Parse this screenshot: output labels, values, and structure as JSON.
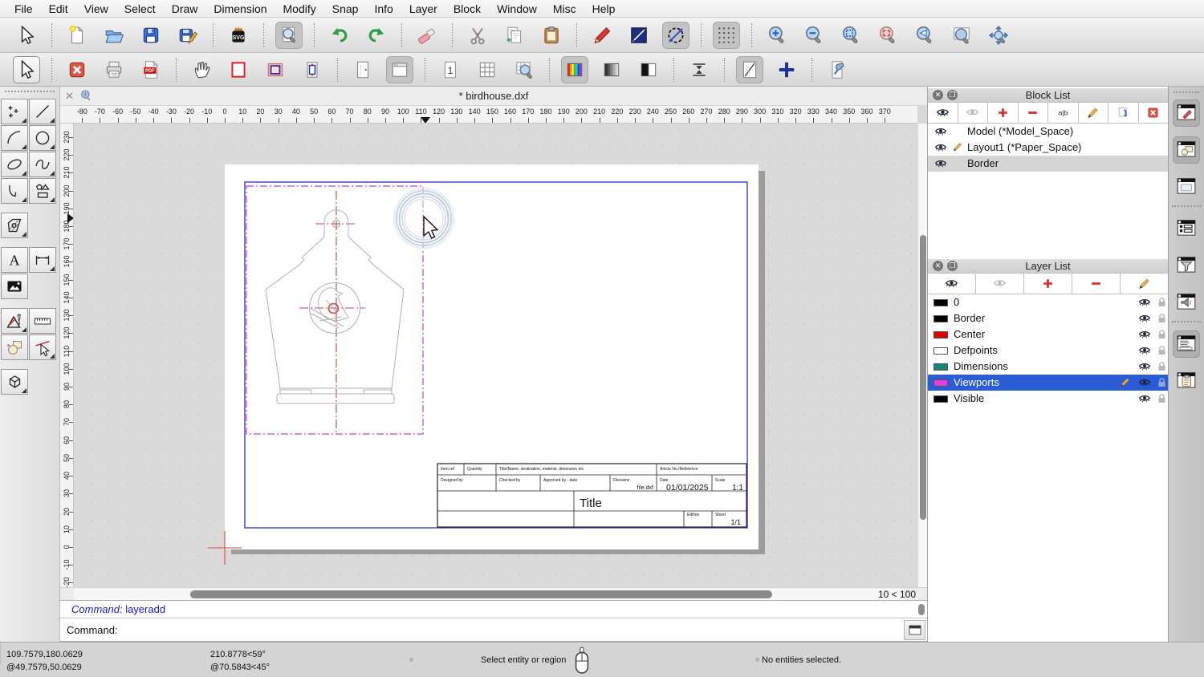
{
  "menu": {
    "items": [
      "File",
      "Edit",
      "View",
      "Select",
      "Draw",
      "Dimension",
      "Modify",
      "Snap",
      "Info",
      "Layer",
      "Block",
      "Window",
      "Misc",
      "Help"
    ]
  },
  "toolbar1": {
    "buttons": [
      "cursor",
      "|",
      "new",
      "open",
      "save",
      "saveas",
      "|",
      "svgexp",
      "|",
      [
        "printpreview",
        "a"
      ],
      "|",
      "undo",
      "redo",
      "|",
      "eraser",
      "|",
      "cut",
      "copy",
      "paste",
      "|",
      "penred",
      "navyline",
      [
        "circleblue",
        "a"
      ],
      "|",
      [
        "griddots",
        "a"
      ],
      "|",
      "zoomin",
      "zoomout",
      "zoomauto",
      "zoomprev",
      "zoomback",
      "zoomwindow",
      "zoompan"
    ]
  },
  "toolbar2": {
    "buttons": [
      [
        "cursor",
        "frame"
      ],
      "|",
      "closex",
      "print",
      "pdf",
      "|",
      "hand",
      "redrect",
      "vprect",
      "fitrect",
      "|",
      "panel",
      [
        "windowlt",
        "a"
      ],
      "|",
      "one",
      "gridicon",
      "zoomgrid",
      "|",
      [
        "rainbow",
        "a"
      ],
      "gradgray",
      "bw",
      "|",
      "collapse",
      "|",
      [
        "draft",
        "a"
      ],
      "bluecross",
      "|",
      "wrench"
    ]
  },
  "palette": {
    "groups": [
      [
        [
          [
            "points",
            1
          ],
          [
            "line",
            1
          ]
        ],
        [
          [
            "arc",
            1
          ],
          [
            "circle",
            1
          ]
        ],
        [
          [
            "ellipse",
            1
          ],
          [
            "spline",
            1
          ]
        ],
        [
          [
            "polyline",
            1
          ],
          [
            "shapes",
            1
          ]
        ]
      ],
      [
        [
          [
            "hatch",
            1
          ],
          null
        ]
      ],
      [
        [
          [
            "text",
            0
          ],
          [
            "dim",
            1
          ]
        ],
        [
          [
            "image",
            0
          ],
          null
        ]
      ],
      [
        [
          [
            "drawtools",
            1
          ],
          [
            "ruler",
            0
          ]
        ],
        [
          [
            "blocks",
            0
          ],
          [
            "selectline",
            1
          ]
        ]
      ],
      [
        [
          [
            "box3d",
            1
          ],
          null
        ]
      ]
    ]
  },
  "tab": {
    "title": "* birdhouse.dxf"
  },
  "ruler": {
    "h": {
      "min": -80,
      "max": 370,
      "step": 10
    },
    "v": {
      "min": -20,
      "max": 230,
      "step": 10
    }
  },
  "zoom_indicator": "10 < 100",
  "command": {
    "history_label": "Command:",
    "history_value": " layeradd",
    "prompt_label": "Command:"
  },
  "status": {
    "coord_abs": "109.7579,180.0629",
    "coord_rel": "@49.7579,50.0629",
    "polar_abs": "210.8778<59°",
    "polar_rel": "@70.5843<45°",
    "hint": "Select entity or region",
    "selection": "No entities selected."
  },
  "block_list": {
    "title": "Block List",
    "items": [
      {
        "label": "Model (*Model_Space)"
      },
      {
        "label": "Layout1 (*Paper_Space)",
        "pencil": true
      },
      {
        "label": "Border",
        "selected": true
      }
    ]
  },
  "layer_list": {
    "title": "Layer List",
    "items": [
      {
        "label": "0",
        "color": "#000000"
      },
      {
        "label": "Border",
        "color": "#000000"
      },
      {
        "label": "Center",
        "color": "#e00000"
      },
      {
        "label": "Defpoints",
        "color": "#ffffff"
      },
      {
        "label": "Dimensions",
        "color": "#18857c"
      },
      {
        "label": "Viewports",
        "color": "#e13ee1",
        "selected": true,
        "pencil": true
      },
      {
        "label": "Visible",
        "color": "#000000"
      }
    ]
  },
  "strip": {
    "buttons": [
      [
        "win-pencil",
        "a"
      ],
      [
        "win-shapes",
        "a"
      ],
      "win-blank",
      "|",
      "win-list",
      "win-funnel",
      "win-speaker",
      "|",
      [
        "win-command",
        "a"
      ],
      "win-clipboard"
    ]
  },
  "title_block": {
    "item_ref": "Item ref",
    "quantity": "Quantity",
    "title_name": "Title/Name, destination, material, dimension etc",
    "article": "Article No./Reference",
    "designed_by": "Designed by",
    "checked_by": "Checked by",
    "approved_by": "Approved by - date",
    "filename_label": "Filename",
    "filename_value": "file.dxf",
    "date_label": "Date",
    "date_value": "01/01/2025",
    "scale_label": "Scale",
    "scale_value": "1:1",
    "title": "Title",
    "edition_label": "Edition",
    "sheet_label": "Sheet",
    "sheet_value": "1/1"
  }
}
